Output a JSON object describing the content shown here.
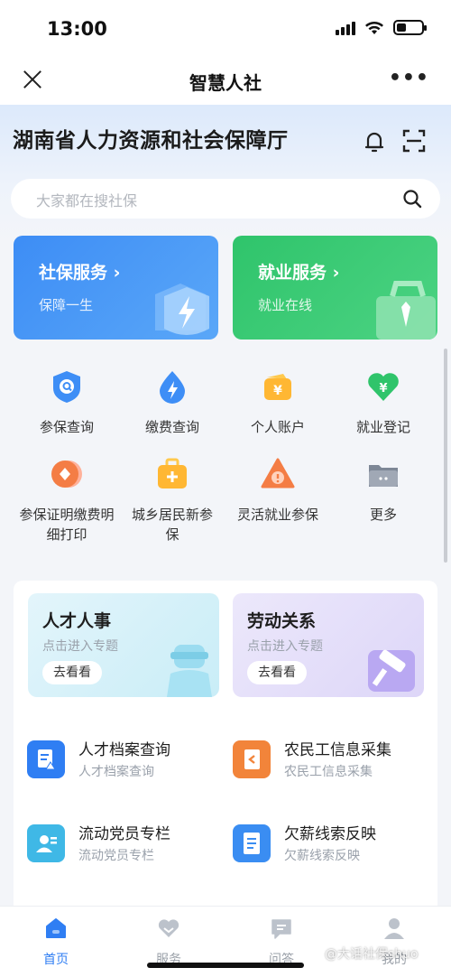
{
  "status": {
    "time": "13:00"
  },
  "nav": {
    "title": "智慧人社"
  },
  "header": {
    "org_name": "湖南省人力资源和社会保障厅"
  },
  "search": {
    "placeholder": "大家都在搜社保"
  },
  "feature_cards": [
    {
      "title": "社保服务",
      "subtitle": "保障一生",
      "color": "#3d8df5"
    },
    {
      "title": "就业服务",
      "subtitle": "就业在线",
      "color": "#2fc46b"
    }
  ],
  "grid": [
    {
      "label": "参保查询",
      "icon": "shield-search-icon"
    },
    {
      "label": "缴费查询",
      "icon": "water-drop-bolt-icon"
    },
    {
      "label": "个人账户",
      "icon": "wallet-yuan-icon"
    },
    {
      "label": "就业登记",
      "icon": "heart-yuan-icon"
    },
    {
      "label": "参保证明缴费明细打印",
      "icon": "diamond-printer-icon"
    },
    {
      "label": "城乡居民新参保",
      "icon": "briefcase-plus-icon"
    },
    {
      "label": "灵活就业参保",
      "icon": "warning-triangle-icon"
    },
    {
      "label": "更多",
      "icon": "folder-more-icon"
    }
  ],
  "topics": [
    {
      "title": "人才人事",
      "subtitle": "点击进入专题",
      "button": "去看看"
    },
    {
      "title": "劳动关系",
      "subtitle": "点击进入专题",
      "button": "去看看"
    }
  ],
  "services": [
    {
      "title": "人才档案查询",
      "subtitle": "人才档案查询",
      "color": "#2f7ef3"
    },
    {
      "title": "农民工信息采集",
      "subtitle": "农民工信息采集",
      "color": "#f2843a"
    },
    {
      "title": "流动党员专栏",
      "subtitle": "流动党员专栏",
      "color": "#3fb8e6"
    },
    {
      "title": "欠薪线索反映",
      "subtitle": "欠薪线索反映",
      "color": "#3a8df2"
    }
  ],
  "tabs": [
    {
      "label": "首页",
      "active": true
    },
    {
      "label": "服务",
      "active": false
    },
    {
      "label": "问答",
      "active": false
    },
    {
      "label": "我的",
      "active": false
    }
  ],
  "watermark": "@大话社保shuo"
}
